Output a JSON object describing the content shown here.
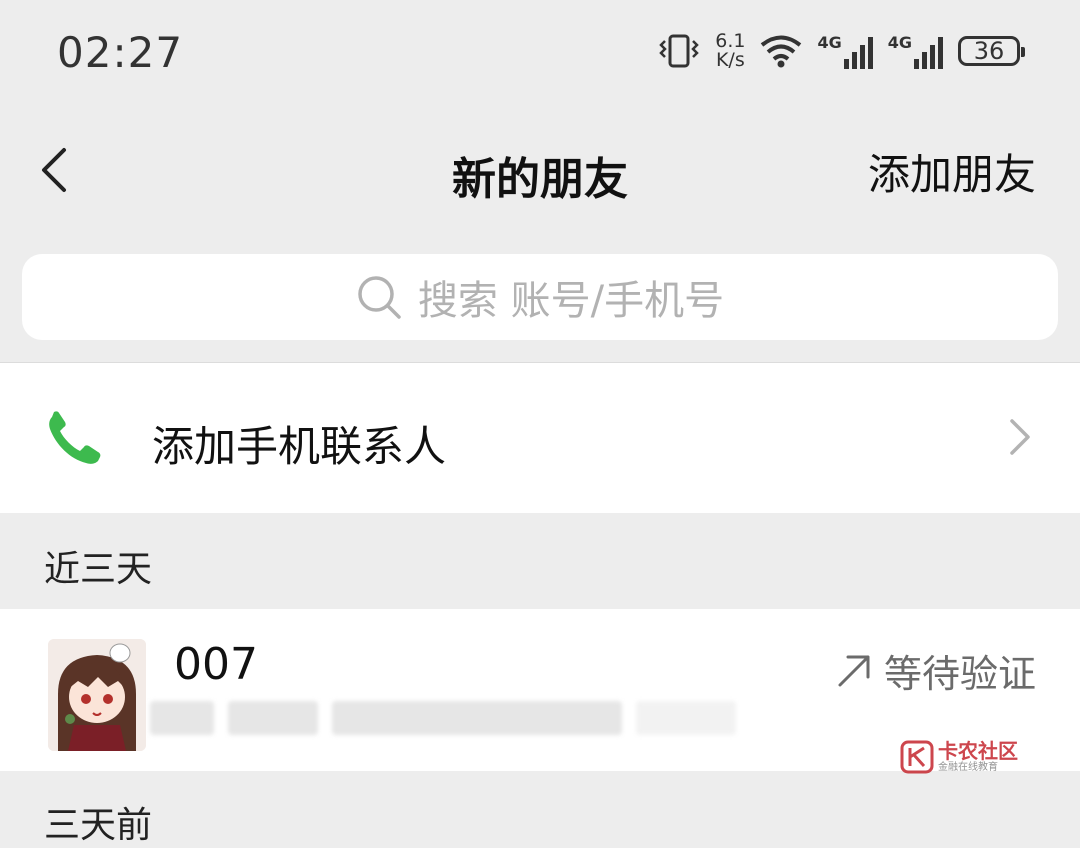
{
  "status_bar": {
    "time": "02:27",
    "net_speed_value": "6.1",
    "net_speed_unit": "K/s",
    "signal_1_label": "4G",
    "signal_2_label": "4G",
    "battery": "36",
    "icons": [
      "vibrate-icon",
      "wifi-icon",
      "signal-icon",
      "signal-icon",
      "battery-icon"
    ]
  },
  "navbar": {
    "title": "新的朋友",
    "action_label": "添加朋友"
  },
  "search": {
    "placeholder": "搜索 账号/手机号"
  },
  "add_contacts": {
    "label": "添加手机联系人",
    "icon": "phone-icon",
    "icon_color": "#3dba4e"
  },
  "sections": {
    "recent": "近三天",
    "older": "三天前"
  },
  "friend_requests": [
    {
      "name": "007",
      "status": "等待验证",
      "status_icon": "arrow-up-right-icon"
    }
  ],
  "watermark": {
    "name": "卡农社区",
    "subtitle": "金融在线教育"
  }
}
